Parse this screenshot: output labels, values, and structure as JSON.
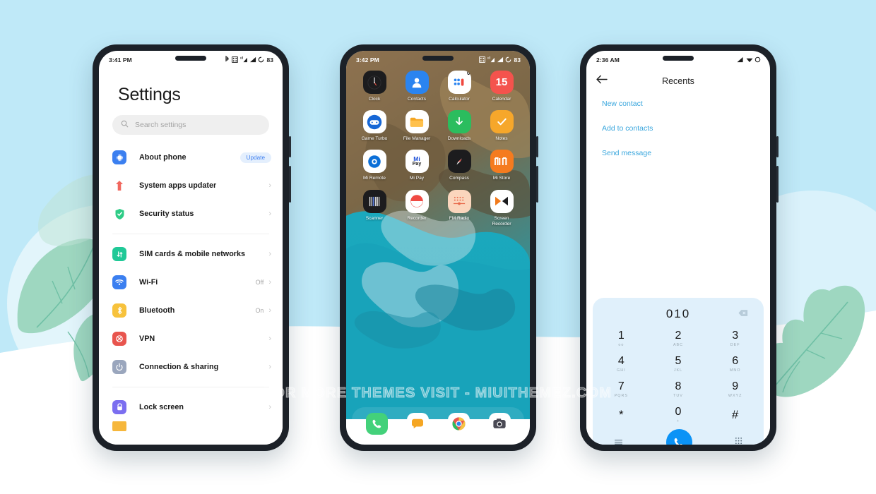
{
  "background": {
    "sky_color": "#bfe9f8",
    "ground_color": "#ffffff",
    "leaf_color": "#9ed7c0",
    "accent_blob": "#daf2fb"
  },
  "watermark": {
    "text": "FOR MORE THEMES VISIT - MIUITHEMEZ.COM"
  },
  "phone1": {
    "status": {
      "time": "3:41 PM",
      "battery": "83",
      "icons": [
        "bluetooth-icon",
        "sim-grid-icon",
        "signal-dual-icon",
        "signal-icon",
        "battery-ring-icon"
      ]
    },
    "settings": {
      "title": "Settings",
      "search_placeholder": "Search settings",
      "groups": [
        {
          "rows": [
            {
              "label": "About phone",
              "icon": "chip-icon",
              "color": "#3b7ff0",
              "badge": "Update",
              "value": "",
              "chevron": false
            },
            {
              "label": "System apps updater",
              "icon": "arrow-up-icon",
              "color": "transparent",
              "badge": "",
              "value": "",
              "chevron": true
            },
            {
              "label": "Security status",
              "icon": "shield-check-icon",
              "color": "#2ecc86",
              "badge": "",
              "value": "",
              "chevron": true
            }
          ]
        },
        {
          "rows": [
            {
              "label": "SIM cards & mobile networks",
              "icon": "sim-icon",
              "color": "#20c997",
              "badge": "",
              "value": "",
              "chevron": true
            },
            {
              "label": "Wi-Fi",
              "icon": "wifi-icon",
              "color": "#3b7ff0",
              "badge": "",
              "value": "Off",
              "chevron": true
            },
            {
              "label": "Bluetooth",
              "icon": "bluetooth-icon",
              "color": "#f7c23c",
              "badge": "",
              "value": "On",
              "chevron": true
            },
            {
              "label": "VPN",
              "icon": "vpn-icon",
              "color": "#e8554e",
              "badge": "",
              "value": "",
              "chevron": true
            },
            {
              "label": "Connection & sharing",
              "icon": "power-share-icon",
              "color": "#9aa6bd",
              "badge": "",
              "value": "",
              "chevron": true
            }
          ]
        },
        {
          "rows": [
            {
              "label": "Lock screen",
              "icon": "lock-icon",
              "color": "#7b6ef0",
              "badge": "",
              "value": "",
              "chevron": true
            }
          ]
        }
      ]
    }
  },
  "phone2": {
    "status": {
      "time": "3:42 PM",
      "battery": "83",
      "icons": [
        "sim-grid-icon",
        "signal-dual-icon",
        "signal-icon",
        "battery-ring-icon"
      ]
    },
    "apps": [
      {
        "label": "Clock",
        "icon": "clock-icon",
        "bg": "#1c1c1e",
        "fg": "#ffffff"
      },
      {
        "label": "Contacts",
        "icon": "contacts-icon",
        "bg": "#2a84f0",
        "fg": "#ffffff"
      },
      {
        "label": "Calculator",
        "icon": "calculator-icon",
        "bg": "#ffffff",
        "fg": "#2a84f0",
        "badge": "0"
      },
      {
        "label": "Calendar",
        "icon": "calendar-icon",
        "bg": "#f4534d",
        "fg": "#ffffff",
        "day": "15"
      },
      {
        "label": "Game Turbo",
        "icon": "gamepad-icon",
        "bg": "#ffffff",
        "fg": "#1667d6"
      },
      {
        "label": "File Manager",
        "icon": "folder-icon",
        "bg": "#ffffff",
        "fg": "#f5a623"
      },
      {
        "label": "Downloads",
        "icon": "download-icon",
        "bg": "#2bbd5e",
        "fg": "#ffffff"
      },
      {
        "label": "Notes",
        "icon": "notes-check-icon",
        "bg": "#f6a72b",
        "fg": "#ffffff"
      },
      {
        "label": "Mi Remote",
        "icon": "remote-icon",
        "bg": "#ffffff",
        "fg": "#0b6fd8"
      },
      {
        "label": "Mi Pay",
        "icon": "mipay-icon",
        "bg": "#ffffff",
        "fg": "#1c4fd8"
      },
      {
        "label": "Compass",
        "icon": "compass-icon",
        "bg": "#1c1c1e",
        "fg": "#ffffff"
      },
      {
        "label": "Mi Store",
        "icon": "mi-logo-icon",
        "bg": "#f57b1f",
        "fg": "#ffffff"
      },
      {
        "label": "Scanner",
        "icon": "barcode-icon",
        "bg": "#1c1c1e",
        "fg": "#ffffff"
      },
      {
        "label": "Recorder",
        "icon": "recorder-icon",
        "bg": "#ffffff",
        "fg": "#f04a43"
      },
      {
        "label": "FM Radio",
        "icon": "radio-icon",
        "bg": "#fbd6bd",
        "fg": "#e8694a"
      },
      {
        "label": "Screen Recorder",
        "icon": "screen-record-icon",
        "bg": "#ffffff",
        "fg": "#f27a1a"
      }
    ],
    "dock": [
      {
        "label": "Phone",
        "icon": "phone-icon",
        "bg": "#43d17a",
        "fg": "#ffffff"
      },
      {
        "label": "Messages",
        "icon": "message-icon",
        "bg": "#ffffff",
        "fg": "#f5a623"
      },
      {
        "label": "Chrome",
        "icon": "chrome-icon",
        "bg": "#ffffff",
        "fg": "#2a84f0"
      },
      {
        "label": "Camera",
        "icon": "camera-icon",
        "bg": "#ffffff",
        "fg": "#4a4a55"
      }
    ]
  },
  "phone3": {
    "status": {
      "time": "2:36 AM",
      "icons": [
        "signal-icon",
        "wifi-icon",
        "battery-ring-icon"
      ]
    },
    "appbar": {
      "back": "back-arrow-icon",
      "title": "Recents"
    },
    "actions": [
      "New contact",
      "Add to contacts",
      "Send message"
    ],
    "dialer": {
      "number": "010",
      "backspace_icon": "backspace-icon",
      "keys": [
        {
          "digit": "1",
          "letters": "oo"
        },
        {
          "digit": "2",
          "letters": "ABC"
        },
        {
          "digit": "3",
          "letters": "DEF"
        },
        {
          "digit": "4",
          "letters": "GHI"
        },
        {
          "digit": "5",
          "letters": "JKL"
        },
        {
          "digit": "6",
          "letters": "MNO"
        },
        {
          "digit": "7",
          "letters": "PQRS"
        },
        {
          "digit": "8",
          "letters": "TUV"
        },
        {
          "digit": "9",
          "letters": "WXYZ"
        },
        {
          "digit": "*",
          "letters": ""
        },
        {
          "digit": "0",
          "letters": "+"
        },
        {
          "digit": "#",
          "letters": ""
        }
      ],
      "bottom": {
        "left_icon": "menu-icon",
        "call_icon": "call-icon",
        "right_icon": "keypad-icon",
        "call_color": "#0b93f6"
      }
    }
  }
}
